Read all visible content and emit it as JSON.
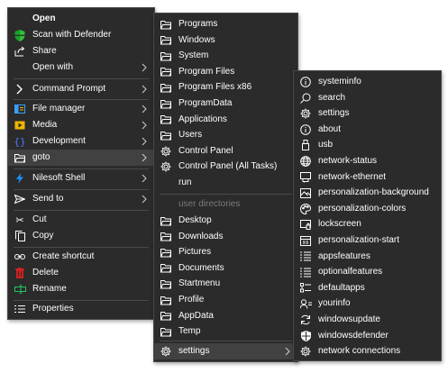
{
  "main_menu": {
    "items": [
      {
        "label": "Open",
        "icon": "none"
      },
      {
        "label": "Scan with Defender",
        "icon": "defender-shield-icon"
      },
      {
        "label": "Share",
        "icon": "share-icon"
      },
      {
        "label": "Open with",
        "icon": "none"
      },
      {
        "label": "Command Prompt",
        "icon": "chevron-right-icon"
      },
      {
        "label": "File manager",
        "icon": "file-manager-icon"
      },
      {
        "label": "Media",
        "icon": "media-icon"
      },
      {
        "label": "Development",
        "icon": "braces-icon"
      },
      {
        "label": "goto",
        "icon": "folder-icon"
      },
      {
        "label": "Nilesoft Shell",
        "icon": "nilesoft-shell-icon"
      },
      {
        "label": "Send to",
        "icon": "send-icon"
      },
      {
        "label": "Cut",
        "icon": "scissors-icon"
      },
      {
        "label": "Copy",
        "icon": "copy-icon"
      },
      {
        "label": "Create shortcut",
        "icon": "shortcut-icon"
      },
      {
        "label": "Delete",
        "icon": "trash-icon"
      },
      {
        "label": "Rename",
        "icon": "rename-icon"
      },
      {
        "label": "Properties",
        "icon": "properties-icon"
      }
    ]
  },
  "goto_menu": {
    "items": [
      {
        "label": "Programs",
        "icon": "folder-icon"
      },
      {
        "label": "Windows",
        "icon": "folder-icon"
      },
      {
        "label": "System",
        "icon": "folder-icon"
      },
      {
        "label": "Program Files",
        "icon": "folder-icon"
      },
      {
        "label": "Program Files x86",
        "icon": "folder-icon"
      },
      {
        "label": "ProgramData",
        "icon": "folder-icon"
      },
      {
        "label": "Applications",
        "icon": "folder-icon"
      },
      {
        "label": "Users",
        "icon": "folder-icon"
      },
      {
        "label": "Control Panel",
        "icon": "gear-icon"
      },
      {
        "label": "Control Panel (All Tasks)",
        "icon": "gear-icon"
      },
      {
        "label": "run",
        "icon": "none"
      },
      {
        "label": "user directories",
        "icon": "none"
      },
      {
        "label": "Desktop",
        "icon": "folder-icon"
      },
      {
        "label": "Downloads",
        "icon": "folder-icon"
      },
      {
        "label": "Pictures",
        "icon": "folder-icon"
      },
      {
        "label": "Documents",
        "icon": "folder-icon"
      },
      {
        "label": "Startmenu",
        "icon": "folder-icon"
      },
      {
        "label": "Profile",
        "icon": "folder-icon"
      },
      {
        "label": "AppData",
        "icon": "folder-icon"
      },
      {
        "label": "Temp",
        "icon": "folder-icon"
      },
      {
        "label": "settings",
        "icon": "gear-icon"
      }
    ]
  },
  "settings_menu": {
    "items": [
      {
        "label": "systeminfo",
        "icon": "info-icon"
      },
      {
        "label": "search",
        "icon": "search-icon"
      },
      {
        "label": "settings",
        "icon": "gear-icon"
      },
      {
        "label": "about",
        "icon": "info-icon"
      },
      {
        "label": "usb",
        "icon": "usb-icon"
      },
      {
        "label": "network-status",
        "icon": "globe-icon"
      },
      {
        "label": "network-ethernet",
        "icon": "ethernet-icon"
      },
      {
        "label": "personalization-background",
        "icon": "image-icon"
      },
      {
        "label": "personalization-colors",
        "icon": "palette-icon"
      },
      {
        "label": "lockscreen",
        "icon": "lockscreen-icon"
      },
      {
        "label": "personalization-start",
        "icon": "start-icon"
      },
      {
        "label": "appsfeatures",
        "icon": "list-icon"
      },
      {
        "label": "optionalfeatures",
        "icon": "list-icon"
      },
      {
        "label": "defaultapps",
        "icon": "defaultapps-icon"
      },
      {
        "label": "yourinfo",
        "icon": "person-icon"
      },
      {
        "label": "windowsupdate",
        "icon": "refresh-icon"
      },
      {
        "label": "windowsdefender",
        "icon": "shield-icon"
      },
      {
        "label": "network connections",
        "icon": "gear-icon"
      }
    ]
  },
  "colors": {
    "menu_bg": "#2b2b2b",
    "highlight": "#414141",
    "text": "#ffffff",
    "dim_text": "#7a7a7a",
    "defender_green": "#2fbf3a",
    "nilesoft_blue": "#1e90ff",
    "file_manager_blue": "#3aa0ff",
    "media_yellow": "#f0b400",
    "dev_blue": "#4d7cff",
    "delete_red": "#d32020",
    "rename_green": "#22c55e"
  }
}
